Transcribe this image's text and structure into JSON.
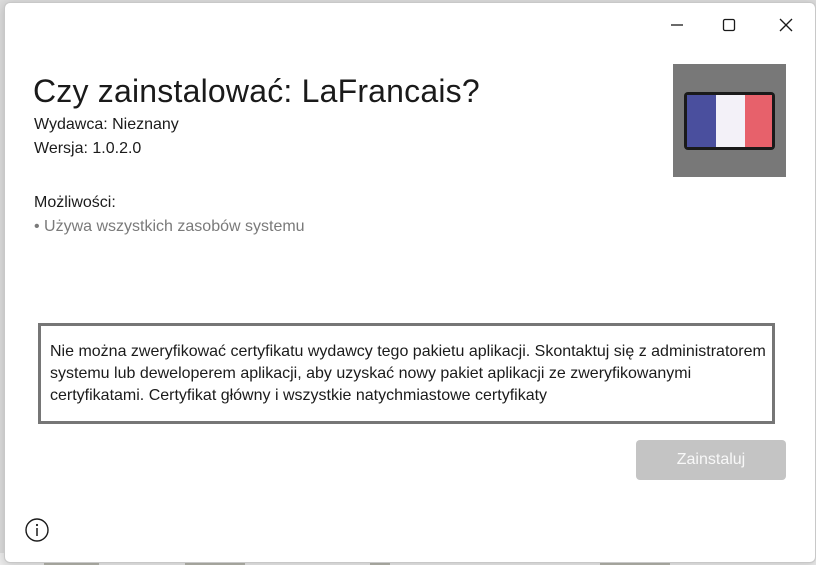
{
  "window": {
    "controls": {
      "minimize_icon": "minimize-icon",
      "maximize_icon": "maximize-icon",
      "close_icon": "close-icon"
    }
  },
  "installer": {
    "title": "Czy zainstalować: LaFrancais?",
    "publisher": "Wydawca: Nieznany",
    "version": "Wersja: 1.0.2.0",
    "capabilities_heading": "Możliwości:",
    "capabilities": [
      "• Używa wszystkich zasobów systemu"
    ],
    "warning_text": "Nie można zweryfikować certyfikatu wydawcy tego pakietu aplikacji. Skontaktuj się z administratorem systemu lub deweloperem aplikacji, aby uzyskać nowy pakiet aplikacji ze zweryfikowanymi certyfikatami. Certyfikat główny i wszystkie natychmiastowe certyfikaty",
    "install_button": "Zainstaluj",
    "install_enabled": false,
    "info_icon": "info-icon",
    "app_logo": {
      "icon": "french-flag-logo",
      "colors": {
        "background": "#787878",
        "blue": "#4a4f9e",
        "white": "#f3f1f8",
        "red": "#e7616b",
        "outline": "#1a1a1a"
      }
    }
  }
}
